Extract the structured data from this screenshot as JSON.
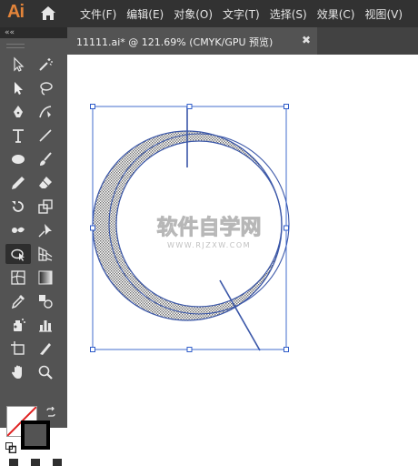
{
  "app": {
    "logo": "Ai"
  },
  "menu": {
    "items": [
      "文件(F)",
      "编辑(E)",
      "对象(O)",
      "文字(T)",
      "选择(S)",
      "效果(C)",
      "视图(V)"
    ]
  },
  "toolbar": {
    "collapse_glyph": "««",
    "tools": [
      "selection-tool",
      "magic-wand-tool",
      "direct-selection-tool",
      "lasso-tool",
      "pen-tool",
      "curvature-tool",
      "type-tool",
      "line-segment-tool",
      "ellipse-tool",
      "paintbrush-tool",
      "pencil-tool",
      "eraser-tool",
      "rotate-tool",
      "scale-tool",
      "puppet-warp-tool",
      "pushpin-tool",
      "shape-builder-tool",
      "perspective-grid-tool",
      "mesh-tool",
      "gradient-tool",
      "eyedropper-tool",
      "blend-tool",
      "symbol-sprayer-tool",
      "column-graph-tool",
      "artboard-tool",
      "slice-tool",
      "hand-tool",
      "zoom-tool"
    ],
    "active_tool": "shape-builder-tool",
    "fill_color": "#ffffff",
    "stroke_color": "#000000",
    "none_slash_color": "#e02020"
  },
  "document": {
    "tab_label": "11111.ai* @ 121.69% (CMYK/GPU 预览)",
    "close_glyph": "✖"
  },
  "artwork": {
    "selection_color": "#2f5cc9",
    "stroke_color": "#3b57a8",
    "pattern_color": "#6b6b6b"
  },
  "watermark": {
    "main": "软件自学网",
    "sub": "WWW.RJZXW.COM"
  }
}
